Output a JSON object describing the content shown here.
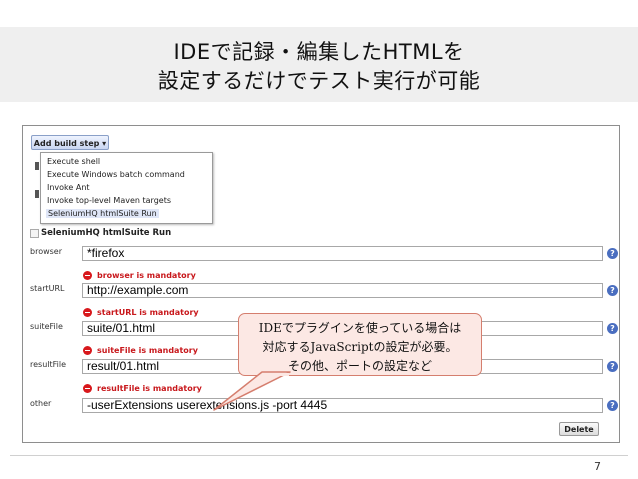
{
  "slide": {
    "title_line1": "IDEで記録・編集したHTMLを",
    "title_line2": "設定するだけでテスト実行が可能",
    "page_number": "7"
  },
  "screenshot": {
    "add_build_step": "Add build step ▾",
    "menu_items": [
      "Execute shell",
      "Execute Windows batch command",
      "Invoke Ant",
      "Invoke top-level Maven targets",
      "SeleniumHQ htmlSuite Run"
    ],
    "section_title": "SeleniumHQ htmlSuite Run",
    "fields": [
      {
        "label": "browser",
        "value": "*firefox",
        "error": "browser is mandatory"
      },
      {
        "label": "startURL",
        "value": "http://example.com",
        "error": "startURL is mandatory"
      },
      {
        "label": "suiteFile",
        "value": "suite/01.html",
        "error": "suiteFile is mandatory"
      },
      {
        "label": "resultFile",
        "value": "result/01.html",
        "error": "resultFile is mandatory"
      },
      {
        "label": "other",
        "value": "-userExtensions userextensions.js  -port 4445"
      }
    ],
    "help_glyph": "?",
    "delete_label": "Delete"
  },
  "callout": {
    "line1": "IDEでプラグインを使っている場合は",
    "line2": "対応するJavaScriptの設定が必要。",
    "line3": "その他、ポートの設定など"
  },
  "colors": {
    "error_red": "#c8181c",
    "callout_fill": "#fce8e4",
    "callout_border": "#d57e6e",
    "help_blue": "#4a6ec0"
  }
}
